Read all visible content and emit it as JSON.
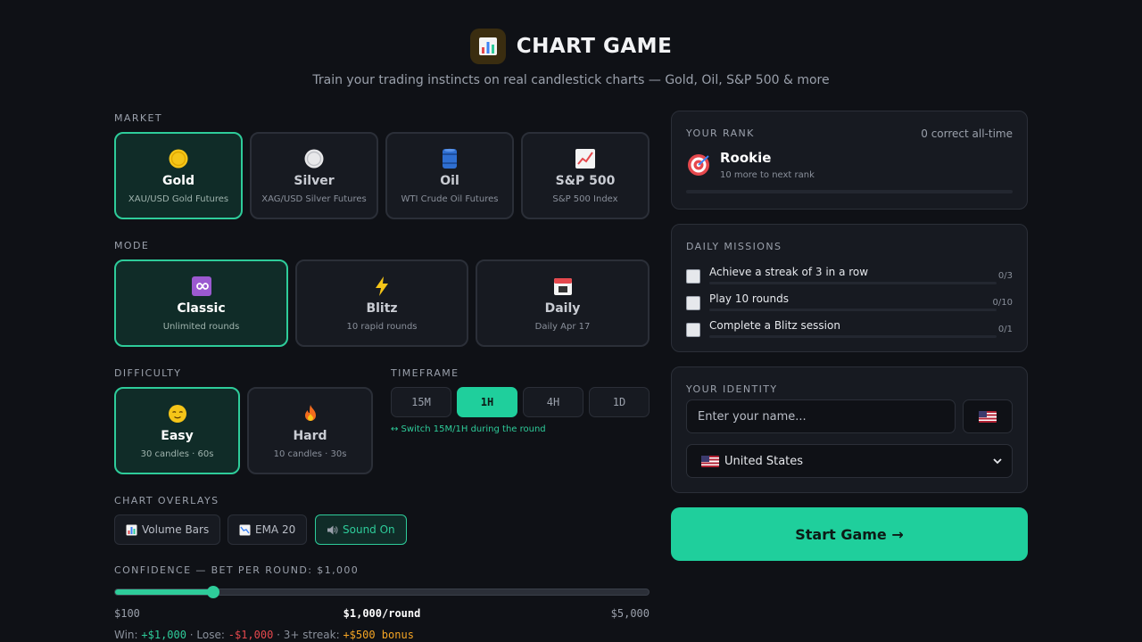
{
  "header": {
    "title": "CHART GAME",
    "subtitle": "Train your trading instincts on real candlestick charts — Gold, Oil, S&P 500 & more",
    "logo_icon": "bar-chart-icon"
  },
  "market": {
    "label": "MARKET",
    "items": [
      {
        "name": "Gold",
        "desc": "XAU/USD Gold Futures",
        "icon": "gold-coin-icon",
        "selected": true
      },
      {
        "name": "Silver",
        "desc": "XAG/USD Silver Futures",
        "icon": "silver-coin-icon",
        "selected": false
      },
      {
        "name": "Oil",
        "desc": "WTI Crude Oil Futures",
        "icon": "oil-barrel-icon",
        "selected": false
      },
      {
        "name": "S&P 500",
        "desc": "S&P 500 Index",
        "icon": "trend-up-icon",
        "selected": false
      }
    ]
  },
  "mode": {
    "label": "MODE",
    "items": [
      {
        "name": "Classic",
        "desc": "Unlimited rounds",
        "icon": "infinity-icon",
        "selected": true
      },
      {
        "name": "Blitz",
        "desc": "10 rapid rounds",
        "icon": "lightning-icon",
        "selected": false
      },
      {
        "name": "Daily",
        "desc": "Daily Apr 17",
        "icon": "calendar-icon",
        "selected": false
      }
    ]
  },
  "difficulty": {
    "label": "DIFFICULTY",
    "items": [
      {
        "name": "Easy",
        "desc": "30 candles · 60s",
        "icon": "relieved-face-icon",
        "selected": true
      },
      {
        "name": "Hard",
        "desc": "10 candles · 30s",
        "icon": "fire-icon",
        "selected": false
      }
    ]
  },
  "timeframe": {
    "label": "TIMEFRAME",
    "options": [
      "15M",
      "1H",
      "4H",
      "1D"
    ],
    "selected": "1H",
    "note": "↔ Switch 15M/1H during the round"
  },
  "overlays": {
    "label": "CHART OVERLAYS",
    "items": [
      {
        "label": "Volume Bars",
        "icon": "bar-chart-icon",
        "active": false
      },
      {
        "label": "EMA 20",
        "icon": "trend-down-icon",
        "active": false
      },
      {
        "label": "Sound On",
        "icon": "speaker-icon",
        "active": true
      }
    ]
  },
  "confidence": {
    "label": "CONFIDENCE — BET PER ROUND: $1,000",
    "min_label": "$100",
    "max_label": "$5,000",
    "current_label": "$1,000/round",
    "min": 100,
    "max": 5000,
    "value": 1000,
    "win_prefix": "Win: ",
    "win_value": "+$1,000",
    "lose_prefix": " · Lose: ",
    "lose_value": "-$1,000",
    "streak_prefix": " · 3+ streak: ",
    "streak_value": "+$500 bonus"
  },
  "rank": {
    "label": "YOUR RANK",
    "correct_text": "0 correct all-time",
    "name": "Rookie",
    "next_text": "10 more to next rank",
    "icon": "target-icon",
    "progress": 0
  },
  "missions": {
    "label": "DAILY MISSIONS",
    "items": [
      {
        "text": "Achieve a streak of 3 in a row",
        "count": "0/3",
        "progress": 0
      },
      {
        "text": "Play 10 rounds",
        "count": "0/10",
        "progress": 0
      },
      {
        "text": "Complete a Blitz session",
        "count": "0/1",
        "progress": 0
      }
    ]
  },
  "identity": {
    "label": "YOUR IDENTITY",
    "name_placeholder": "Enter your name...",
    "name_value": "",
    "flag_icon": "us-flag-icon",
    "country": "United States"
  },
  "start_button": {
    "label": "Start Game →"
  },
  "colors": {
    "accent": "#1fcf9c",
    "background": "#0f1116",
    "card": "#171a21",
    "lose": "#e5484d",
    "bonus": "#f5a524"
  }
}
